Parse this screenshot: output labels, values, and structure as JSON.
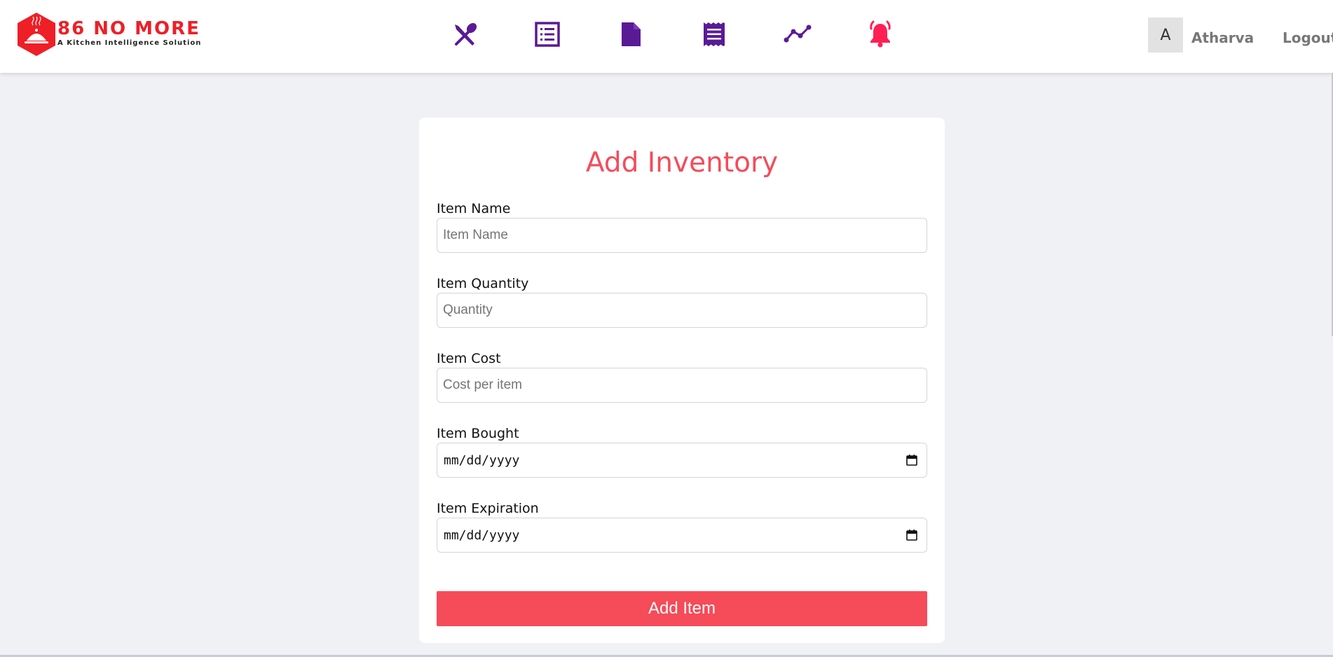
{
  "brand": {
    "title": "86 NO MORE",
    "subtitle": "A Kitchen Intelligence Solution",
    "color": "#ee1f26"
  },
  "nav": {
    "icons": [
      {
        "name": "utensils-icon"
      },
      {
        "name": "list-icon"
      },
      {
        "name": "document-icon"
      },
      {
        "name": "receipt-icon"
      },
      {
        "name": "trend-line-icon"
      },
      {
        "name": "alert-bell-icon"
      }
    ],
    "icon_color": "#5a1a96",
    "alert_color": "#ff1f55"
  },
  "user": {
    "avatar_initial": "A",
    "name": "Atharva",
    "logout_label": "Logout"
  },
  "form": {
    "title": "Add Inventory",
    "fields": {
      "name": {
        "label": "Item Name",
        "placeholder": "Item Name",
        "value": ""
      },
      "quantity": {
        "label": "Item Quantity",
        "placeholder": "Quantity",
        "value": ""
      },
      "cost": {
        "label": "Item Cost",
        "placeholder": "Cost per item",
        "value": ""
      },
      "bought": {
        "label": "Item Bought",
        "value": "mm/dd/yyyy"
      },
      "expiration": {
        "label": "Item Expiration",
        "value": "mm/dd/yyyy"
      }
    },
    "submit_label": "Add Item",
    "accent_color": "#f64b58"
  }
}
